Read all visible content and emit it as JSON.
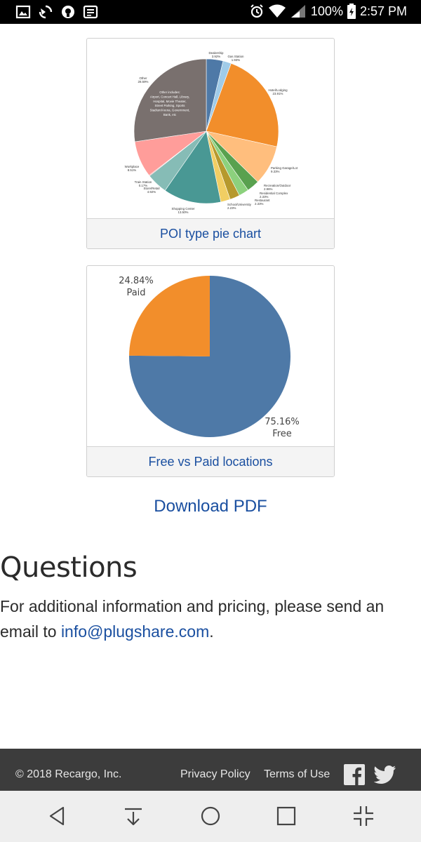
{
  "status_bar": {
    "battery": "100%",
    "time": "2:57 PM",
    "icons": [
      "image-icon",
      "sync-icon",
      "notification-icon",
      "news-icon",
      "alarm-icon",
      "wifi-icon",
      "signal-icon",
      "battery-icon"
    ]
  },
  "figures": {
    "poi": {
      "caption": "POI type pie chart",
      "center_text": [
        "Other includes:",
        "Airport, Concert Hall, Library,",
        "Hospital, Movie Theater,",
        "Street Parking, Sports",
        "Stadium/Arena, Government,",
        "Bank, etc"
      ],
      "labels": {
        "dealership": [
          "Dealership",
          "3.92%"
        ],
        "gas": [
          "Gas Station",
          "1.93%"
        ],
        "hotel": [
          "Hotel/Lodging",
          "23.91%"
        ],
        "parking": [
          "Parking Garage/Lot",
          "9.33%"
        ],
        "recreation": [
          "Recreation/Outdoor",
          "2.96%"
        ],
        "residential": [
          "Residential Complex",
          "2.33%"
        ],
        "restaurant": [
          "Restaurant",
          "2.33%"
        ],
        "school": [
          "School/University",
          "2.23%"
        ],
        "shopping": [
          "Shopping Center",
          "13.50%"
        ],
        "store": [
          "Store/Retail",
          "4.92%"
        ],
        "train": [
          "Train Station",
          "0.17%"
        ],
        "workplace": [
          "Workplace",
          "8.51%"
        ],
        "other": [
          "Other",
          "28.59%"
        ]
      }
    },
    "freepaid": {
      "caption": "Free vs Paid locations",
      "paid_pct": "24.84%",
      "paid_label": "Paid",
      "free_pct": "75.16%",
      "free_label": "Free"
    }
  },
  "chart_data": [
    {
      "type": "pie",
      "title": "",
      "categories": [
        "Dealership",
        "Gas Station",
        "Hotel/Lodging",
        "Parking Garage/Lot",
        "Recreation/Outdoor",
        "Residential Complex",
        "Restaurant",
        "School/University",
        "Shopping Center",
        "Store/Retail",
        "Train Station",
        "Workplace",
        "Other"
      ],
      "values": [
        3.92,
        1.93,
        23.91,
        9.33,
        2.96,
        2.33,
        2.33,
        2.23,
        13.5,
        4.92,
        0.17,
        8.51,
        28.59
      ],
      "colors": [
        "#4e79a7",
        "#a0cbe8",
        "#f28e2b",
        "#ffbe7d",
        "#59a14f",
        "#8cd17d",
        "#b6992d",
        "#f1ce63",
        "#499894",
        "#86bcb6",
        "#e15759",
        "#ff9d9a",
        "#79706e"
      ]
    },
    {
      "type": "pie",
      "title": "",
      "categories": [
        "Paid",
        "Free"
      ],
      "values": [
        24.84,
        75.16
      ],
      "colors": [
        "#f28e2b",
        "#4e79a7"
      ]
    }
  ],
  "download": {
    "label": "Download PDF"
  },
  "questions": {
    "title": "Questions",
    "text": "For additional information and pricing, please send an email to ",
    "email": "info@plugshare.com",
    "suffix": "."
  },
  "footer": {
    "copyright": "© 2018 Recargo, Inc.",
    "privacy": "Privacy Policy",
    "terms": "Terms of Use"
  }
}
